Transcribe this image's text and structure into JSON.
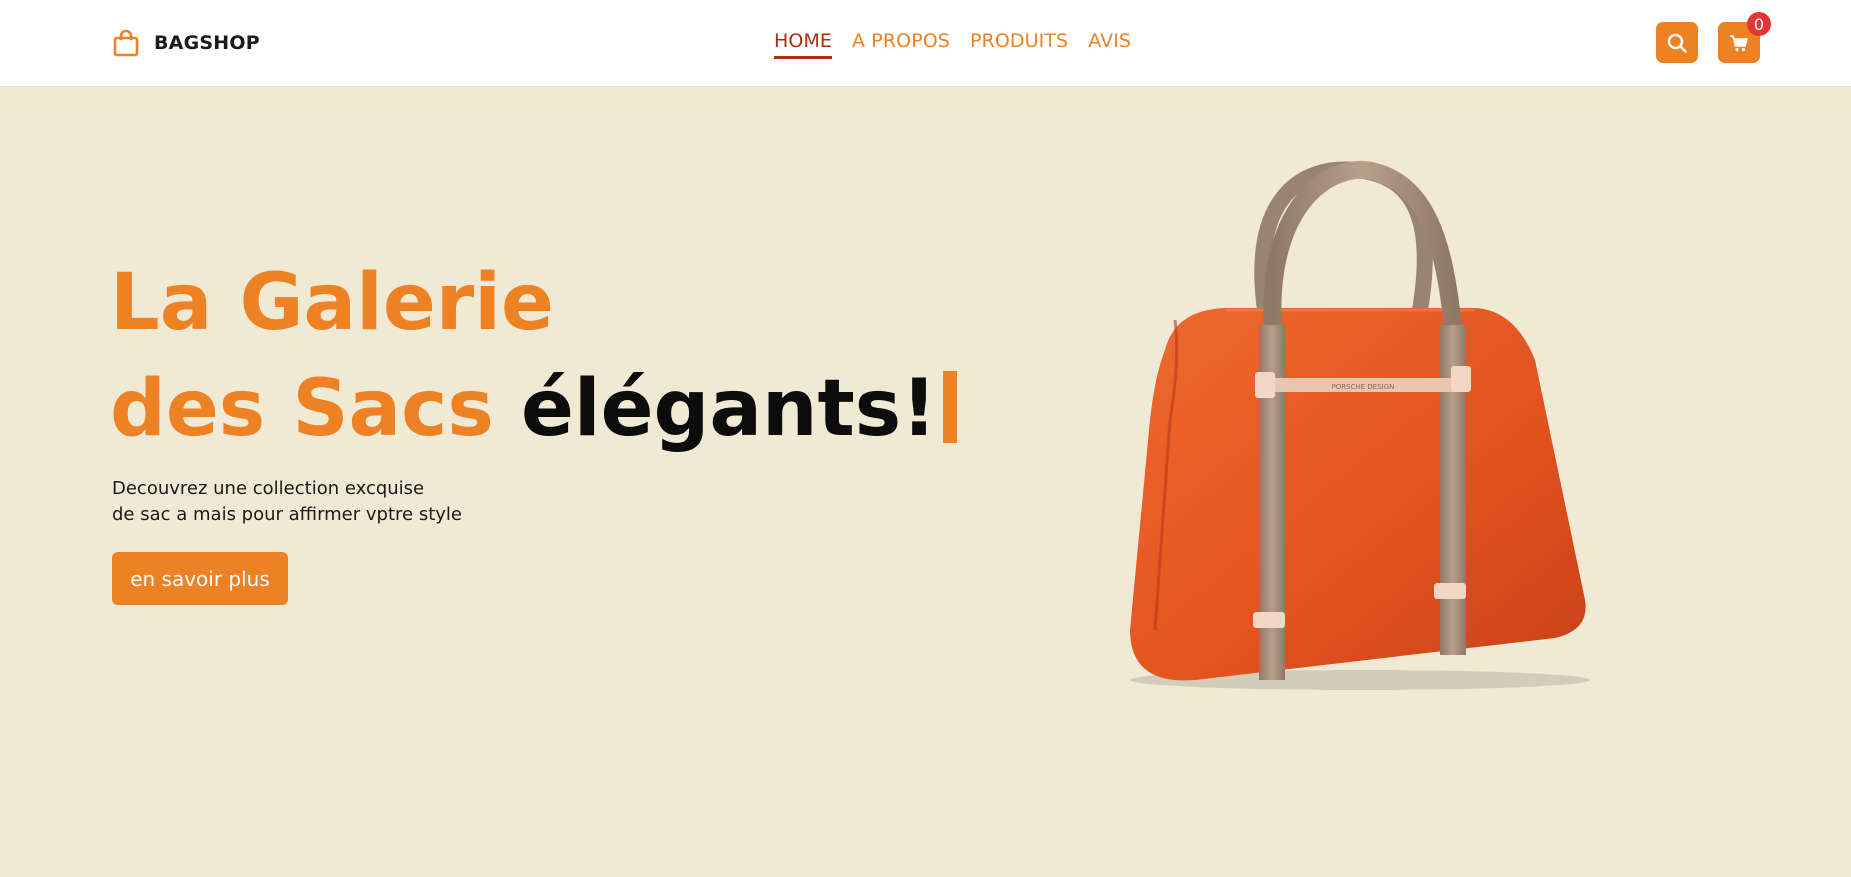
{
  "brand": {
    "name": "BAGSHOP",
    "icon": "shopping-bag-icon"
  },
  "nav": [
    {
      "label": "HOME",
      "active": true
    },
    {
      "label": "A PROPOS",
      "active": false
    },
    {
      "label": "PRODUITS",
      "active": false
    },
    {
      "label": "AVIS",
      "active": false
    }
  ],
  "actions": {
    "search_icon": "search-icon",
    "cart_icon": "cart-icon",
    "cart_count": "0"
  },
  "hero": {
    "title_line1": "La Galerie",
    "title_line2_orange": "des Sacs",
    "title_line2_black": "élégants!",
    "subtitle_line1": "Decouvrez une collection excquise",
    "subtitle_line2": "de sac a mais pour affirmer vptre style",
    "cta_label": "en savoir plus",
    "bag_strap_plate_text": "PORSCHE DESIGN"
  },
  "colors": {
    "accent": "#ee8124",
    "nav_active": "#a8300c",
    "background": "#f0e9d4",
    "header": "#ffffff",
    "badge": "#e23636",
    "bag_body": "#e2521e",
    "bag_strap": "#a8907b"
  }
}
